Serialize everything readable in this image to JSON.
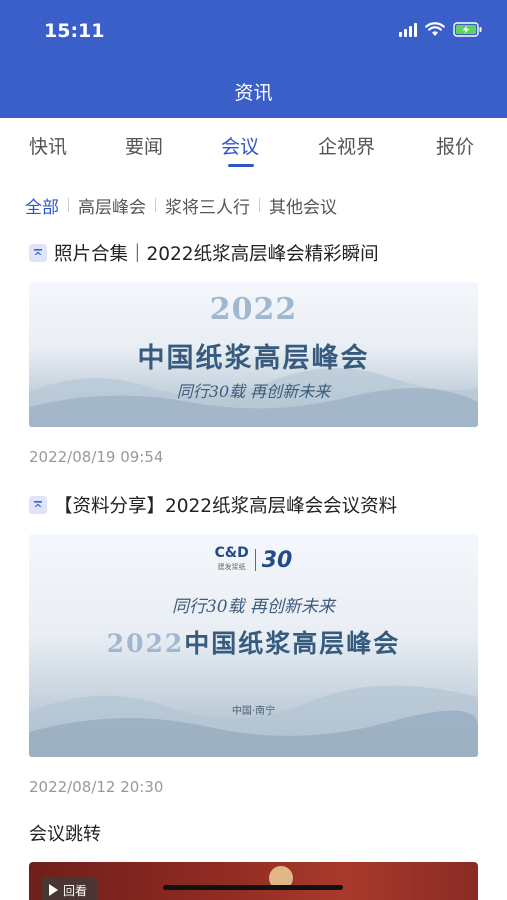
{
  "status_bar": {
    "time": "15:11"
  },
  "header": {
    "title": "资讯"
  },
  "tabs": [
    {
      "label": "快讯"
    },
    {
      "label": "要闻"
    },
    {
      "label": "会议"
    },
    {
      "label": "企视界"
    },
    {
      "label": "报价"
    }
  ],
  "active_tab": "会议",
  "filters": [
    {
      "label": "全部"
    },
    {
      "label": "高层峰会"
    },
    {
      "label": "浆将三人行"
    },
    {
      "label": "其他会议"
    }
  ],
  "articles": [
    {
      "title": "照片合集｜2022纸浆高层峰会精彩瞬间",
      "banner": {
        "year": "2022",
        "main": "中国纸浆高层峰会",
        "slogan": "同行30载 再创新未来"
      },
      "date": "2022/08/19 09:54"
    },
    {
      "title": "【资料分享】2022纸浆高层峰会会议资料",
      "banner": {
        "logo_cd": "C&D",
        "logo_cd_sub": "建发浆纸",
        "logo_30": "30",
        "slogan": "同行30载 再创新未来",
        "year": "2022",
        "main": "中国纸浆高层峰会",
        "location": "中国·南宁"
      },
      "date": "2022/08/12 20:30"
    }
  ],
  "section": {
    "title": "会议跳转"
  },
  "video_card": {
    "badge": "回看"
  },
  "colors": {
    "primary": "#3a5fc9",
    "active": "#2f56c8"
  },
  "icons": [
    "signal-icon",
    "wifi-icon",
    "battery-charging-icon",
    "pin-top-icon",
    "play-icon"
  ]
}
